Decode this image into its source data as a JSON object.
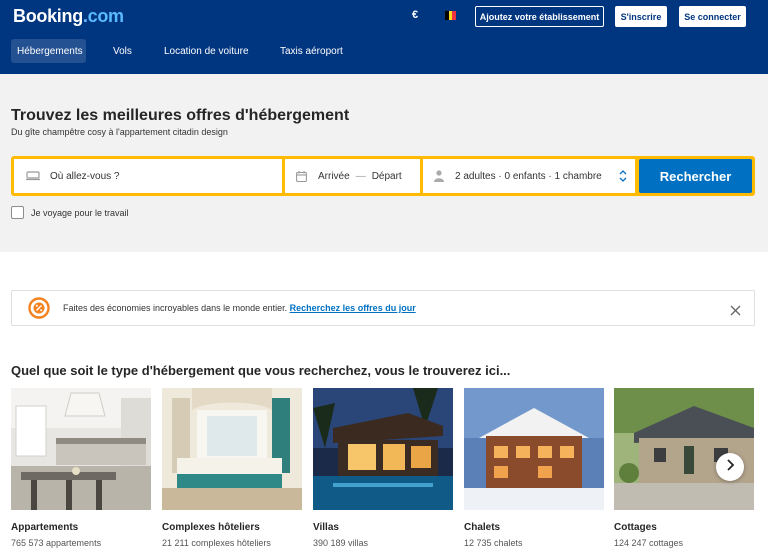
{
  "header": {
    "logo_main": "Booking",
    "logo_suffix": ".com",
    "currency": "€",
    "list_property": "Ajoutez votre établissement",
    "register": "S'inscrire",
    "login": "Se connecter",
    "flag_colors": [
      "#000000",
      "#fdda24",
      "#ef3340"
    ]
  },
  "nav": {
    "items": [
      {
        "label": "Hébergements",
        "active": true
      },
      {
        "label": "Vols"
      },
      {
        "label": "Location de voiture"
      },
      {
        "label": "Taxis aéroport"
      }
    ]
  },
  "hero": {
    "title": "Trouvez les meilleures offres d'hébergement",
    "subtitle": "Du gîte champêtre cosy à l'appartement citadin design"
  },
  "search": {
    "destination_placeholder": "Où allez-vous ?",
    "checkin": "Arrivée",
    "dash": "—",
    "checkout": "Départ",
    "guests": "2 adultes · 0 enfants · 1 chambre",
    "button": "Rechercher",
    "business_travel": "Je voyage pour le travail"
  },
  "banner": {
    "text": "Faites des économies incroyables dans le monde entier.",
    "link": "Recherchez les offres du jour"
  },
  "section": {
    "title": "Quel que soit le type d'hébergement que vous recherchez, vous le trouverez ici..."
  },
  "property_types": [
    {
      "name": "Appartements",
      "count": "765 573 appartements"
    },
    {
      "name": "Complexes hôteliers",
      "count": "21 211 complexes hôteliers"
    },
    {
      "name": "Villas",
      "count": "390 189 villas"
    },
    {
      "name": "Chalets",
      "count": "12 735 chalets"
    },
    {
      "name": "Cottages",
      "count": "124 247 cottages"
    }
  ],
  "colors": {
    "brand_blue": "#003580",
    "accent_blue": "#0071c2",
    "search_border": "#febb02",
    "deal_orange": "#f5821f"
  },
  "icons": [
    "bed-icon",
    "calendar-icon",
    "person-icon",
    "updown-icon",
    "deal-badge-icon",
    "close-icon",
    "chevron-right-icon"
  ]
}
